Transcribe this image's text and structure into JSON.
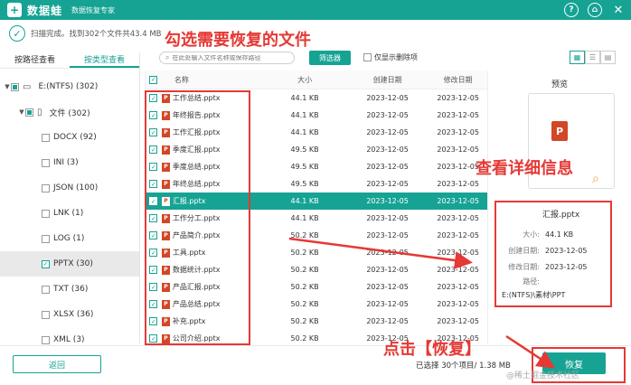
{
  "app": {
    "name": "数据蛙",
    "subtitle": "数据恢复专家",
    "logo_glyph": "+",
    "help_glyph": "?",
    "settings_glyph": "⌂",
    "close_glyph": "✕"
  },
  "status": {
    "text": "扫描完成。找到302个文件共43.4 MB"
  },
  "left_tabs": [
    "按路径查看",
    "按类型查看"
  ],
  "tree": [
    {
      "label": "E:(NTFS) (302)",
      "indent": 0,
      "state": "partial",
      "expander": "▼",
      "icon": "drive-icon"
    },
    {
      "label": "文件 (302)",
      "indent": 1,
      "state": "partial",
      "expander": "▼",
      "icon": "folder-icon"
    },
    {
      "label": "DOCX (92)",
      "indent": 2,
      "state": "empty"
    },
    {
      "label": "INI (3)",
      "indent": 2,
      "state": "empty"
    },
    {
      "label": "JSON (100)",
      "indent": 2,
      "state": "empty"
    },
    {
      "label": "LNK (1)",
      "indent": 2,
      "state": "empty"
    },
    {
      "label": "LOG (1)",
      "indent": 2,
      "state": "empty"
    },
    {
      "label": "PPTX (30)",
      "indent": 2,
      "state": "checked",
      "selected": true
    },
    {
      "label": "TXT (36)",
      "indent": 2,
      "state": "empty"
    },
    {
      "label": "XLSX (36)",
      "indent": 2,
      "state": "empty"
    },
    {
      "label": "XML (3)",
      "indent": 2,
      "state": "empty"
    }
  ],
  "toolbar": {
    "search_placeholder": "在此处输入文件名称或保存路径",
    "filter_label": "筛选器",
    "only_deleted_label": "仅显示删除项"
  },
  "table": {
    "headers": {
      "name": "名称",
      "size": "大小",
      "created": "创建日期",
      "modified": "修改日期"
    },
    "rows": [
      {
        "name": "工作总结.pptx",
        "size": "44.1 KB",
        "created": "2023-12-05",
        "modified": "2023-12-05"
      },
      {
        "name": "年终报告.pptx",
        "size": "44.1 KB",
        "created": "2023-12-05",
        "modified": "2023-12-05"
      },
      {
        "name": "工作汇报.pptx",
        "size": "44.1 KB",
        "created": "2023-12-05",
        "modified": "2023-12-05"
      },
      {
        "name": "季度汇报.pptx",
        "size": "49.5 KB",
        "created": "2023-12-05",
        "modified": "2023-12-05"
      },
      {
        "name": "季度总结.pptx",
        "size": "49.5 KB",
        "created": "2023-12-05",
        "modified": "2023-12-05"
      },
      {
        "name": "年终总结.pptx",
        "size": "49.5 KB",
        "created": "2023-12-05",
        "modified": "2023-12-05"
      },
      {
        "name": "汇报.pptx",
        "size": "44.1 KB",
        "created": "2023-12-05",
        "modified": "2023-12-05",
        "selected": true
      },
      {
        "name": "工作分工.pptx",
        "size": "44.1 KB",
        "created": "2023-12-05",
        "modified": "2023-12-05"
      },
      {
        "name": "产品简介.pptx",
        "size": "50.2 KB",
        "created": "2023-12-05",
        "modified": "2023-12-05"
      },
      {
        "name": "工具.pptx",
        "size": "50.2 KB",
        "created": "2023-12-05",
        "modified": "2023-12-05"
      },
      {
        "name": "数据统计.pptx",
        "size": "50.2 KB",
        "created": "2023-12-05",
        "modified": "2023-12-05"
      },
      {
        "name": "产品汇报.pptx",
        "size": "50.2 KB",
        "created": "2023-12-05",
        "modified": "2023-12-05"
      },
      {
        "name": "产品总结.pptx",
        "size": "50.2 KB",
        "created": "2023-12-05",
        "modified": "2023-12-05"
      },
      {
        "name": "补充.pptx",
        "size": "50.2 KB",
        "created": "2023-12-05",
        "modified": "2023-12-05"
      },
      {
        "name": "公司介绍.pptx",
        "size": "50.2 KB",
        "created": "2023-12-05",
        "modified": "2023-12-05"
      }
    ]
  },
  "preview": {
    "title": "预览",
    "file_name": "汇报.pptx",
    "size_key": "大小:",
    "size_val": "44.1 KB",
    "created_key": "创建日期:",
    "created_val": "2023-12-05",
    "modified_key": "修改日期:",
    "modified_val": "2023-12-05",
    "path_key": "路径:",
    "path_val": "E:(NTFS)\\素材\\PPT"
  },
  "bottom": {
    "back_label": "返回",
    "selection_info": "已选择 30个项目/ 1.38 MB",
    "recover_label": "恢复"
  },
  "annotations": {
    "select_files": "勾选需要恢复的文件",
    "view_details": "查看详细信息",
    "click_recover": "点击【恢复】",
    "watermark": "@稀土掘金技术社区"
  },
  "colors": {
    "accent": "#16a394",
    "annotation": "#e53935",
    "ppt": "#d24726"
  }
}
